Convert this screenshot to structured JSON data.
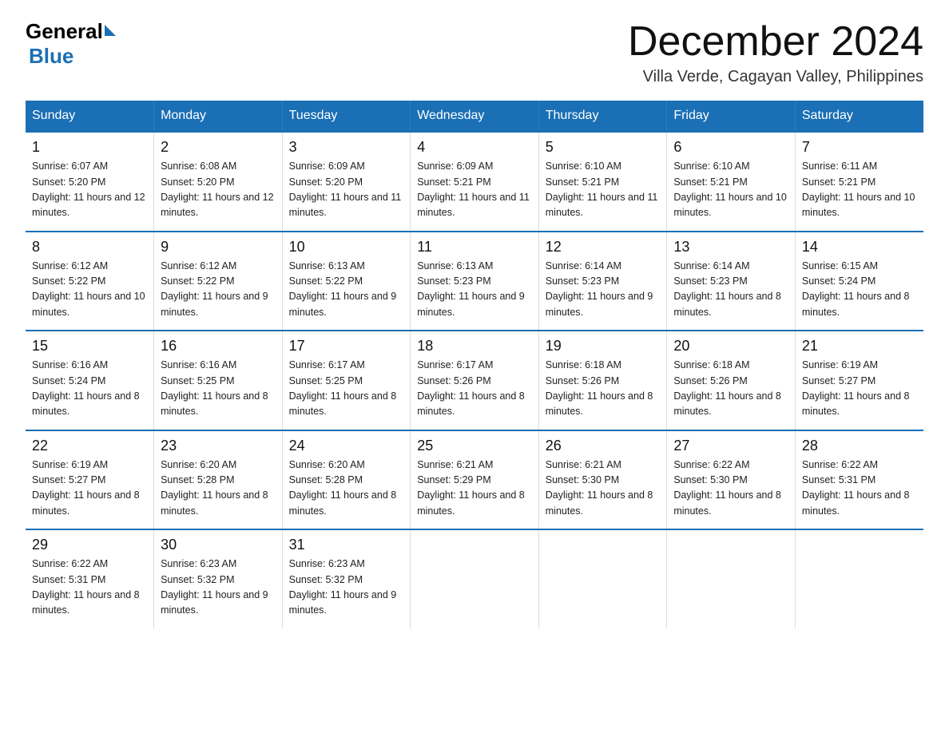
{
  "header": {
    "logo_general": "General",
    "logo_blue": "Blue",
    "month_title": "December 2024",
    "subtitle": "Villa Verde, Cagayan Valley, Philippines"
  },
  "days_of_week": [
    "Sunday",
    "Monday",
    "Tuesday",
    "Wednesday",
    "Thursday",
    "Friday",
    "Saturday"
  ],
  "weeks": [
    [
      {
        "day": "1",
        "sunrise": "6:07 AM",
        "sunset": "5:20 PM",
        "daylight": "11 hours and 12 minutes."
      },
      {
        "day": "2",
        "sunrise": "6:08 AM",
        "sunset": "5:20 PM",
        "daylight": "11 hours and 12 minutes."
      },
      {
        "day": "3",
        "sunrise": "6:09 AM",
        "sunset": "5:20 PM",
        "daylight": "11 hours and 11 minutes."
      },
      {
        "day": "4",
        "sunrise": "6:09 AM",
        "sunset": "5:21 PM",
        "daylight": "11 hours and 11 minutes."
      },
      {
        "day": "5",
        "sunrise": "6:10 AM",
        "sunset": "5:21 PM",
        "daylight": "11 hours and 11 minutes."
      },
      {
        "day": "6",
        "sunrise": "6:10 AM",
        "sunset": "5:21 PM",
        "daylight": "11 hours and 10 minutes."
      },
      {
        "day": "7",
        "sunrise": "6:11 AM",
        "sunset": "5:21 PM",
        "daylight": "11 hours and 10 minutes."
      }
    ],
    [
      {
        "day": "8",
        "sunrise": "6:12 AM",
        "sunset": "5:22 PM",
        "daylight": "11 hours and 10 minutes."
      },
      {
        "day": "9",
        "sunrise": "6:12 AM",
        "sunset": "5:22 PM",
        "daylight": "11 hours and 9 minutes."
      },
      {
        "day": "10",
        "sunrise": "6:13 AM",
        "sunset": "5:22 PM",
        "daylight": "11 hours and 9 minutes."
      },
      {
        "day": "11",
        "sunrise": "6:13 AM",
        "sunset": "5:23 PM",
        "daylight": "11 hours and 9 minutes."
      },
      {
        "day": "12",
        "sunrise": "6:14 AM",
        "sunset": "5:23 PM",
        "daylight": "11 hours and 9 minutes."
      },
      {
        "day": "13",
        "sunrise": "6:14 AM",
        "sunset": "5:23 PM",
        "daylight": "11 hours and 8 minutes."
      },
      {
        "day": "14",
        "sunrise": "6:15 AM",
        "sunset": "5:24 PM",
        "daylight": "11 hours and 8 minutes."
      }
    ],
    [
      {
        "day": "15",
        "sunrise": "6:16 AM",
        "sunset": "5:24 PM",
        "daylight": "11 hours and 8 minutes."
      },
      {
        "day": "16",
        "sunrise": "6:16 AM",
        "sunset": "5:25 PM",
        "daylight": "11 hours and 8 minutes."
      },
      {
        "day": "17",
        "sunrise": "6:17 AM",
        "sunset": "5:25 PM",
        "daylight": "11 hours and 8 minutes."
      },
      {
        "day": "18",
        "sunrise": "6:17 AM",
        "sunset": "5:26 PM",
        "daylight": "11 hours and 8 minutes."
      },
      {
        "day": "19",
        "sunrise": "6:18 AM",
        "sunset": "5:26 PM",
        "daylight": "11 hours and 8 minutes."
      },
      {
        "day": "20",
        "sunrise": "6:18 AM",
        "sunset": "5:26 PM",
        "daylight": "11 hours and 8 minutes."
      },
      {
        "day": "21",
        "sunrise": "6:19 AM",
        "sunset": "5:27 PM",
        "daylight": "11 hours and 8 minutes."
      }
    ],
    [
      {
        "day": "22",
        "sunrise": "6:19 AM",
        "sunset": "5:27 PM",
        "daylight": "11 hours and 8 minutes."
      },
      {
        "day": "23",
        "sunrise": "6:20 AM",
        "sunset": "5:28 PM",
        "daylight": "11 hours and 8 minutes."
      },
      {
        "day": "24",
        "sunrise": "6:20 AM",
        "sunset": "5:28 PM",
        "daylight": "11 hours and 8 minutes."
      },
      {
        "day": "25",
        "sunrise": "6:21 AM",
        "sunset": "5:29 PM",
        "daylight": "11 hours and 8 minutes."
      },
      {
        "day": "26",
        "sunrise": "6:21 AM",
        "sunset": "5:30 PM",
        "daylight": "11 hours and 8 minutes."
      },
      {
        "day": "27",
        "sunrise": "6:22 AM",
        "sunset": "5:30 PM",
        "daylight": "11 hours and 8 minutes."
      },
      {
        "day": "28",
        "sunrise": "6:22 AM",
        "sunset": "5:31 PM",
        "daylight": "11 hours and 8 minutes."
      }
    ],
    [
      {
        "day": "29",
        "sunrise": "6:22 AM",
        "sunset": "5:31 PM",
        "daylight": "11 hours and 8 minutes."
      },
      {
        "day": "30",
        "sunrise": "6:23 AM",
        "sunset": "5:32 PM",
        "daylight": "11 hours and 9 minutes."
      },
      {
        "day": "31",
        "sunrise": "6:23 AM",
        "sunset": "5:32 PM",
        "daylight": "11 hours and 9 minutes."
      },
      null,
      null,
      null,
      null
    ]
  ]
}
